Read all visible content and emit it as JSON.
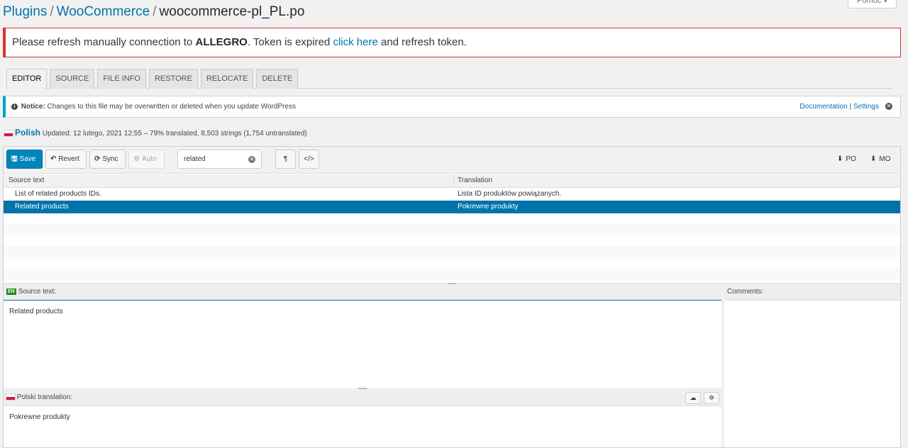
{
  "header": {
    "help_label": "Pomoc ▾",
    "breadcrumb": [
      "Plugins",
      "WooCommerce",
      "woocommerce-pl_PL.po"
    ]
  },
  "alert": {
    "before": "Please refresh manually connection to ",
    "strong": "ALLEGRO",
    "mid": ". Token is expired ",
    "link": "click here",
    "after": " and refresh token."
  },
  "tabs": [
    "EDITOR",
    "SOURCE",
    "FILE INFO",
    "RESTORE",
    "RELOCATE",
    "DELETE"
  ],
  "notice": {
    "label": "Notice:",
    "text": " Changes to this file may be overwritten or deleted when you update WordPress",
    "links": [
      "Documentation",
      "Settings"
    ],
    "close": "✕"
  },
  "language": {
    "name": "Polish",
    "info": "Updated: 12 lutego, 2021 12:55 – 79% translated, 8,503 strings (1,754 untranslated)"
  },
  "toolbar": {
    "save": "Save",
    "revert": "Revert",
    "sync": "Sync",
    "auto": "Auto",
    "search_value": "related",
    "pilcrow": "¶",
    "code": "</>",
    "download_po": "PO",
    "download_mo": "MO",
    "icons": {
      "save": "floppy-icon",
      "revert": "undo-icon",
      "sync": "refresh-icon",
      "auto": "robot-icon",
      "download": "download-icon"
    }
  },
  "list": {
    "headers": [
      "Source text",
      "Translation"
    ],
    "rows": [
      {
        "source": "List of related products IDs.",
        "translation": "Lista ID produktów powiązanych."
      },
      {
        "source": "Related products",
        "translation": "Pokrewne produkty"
      }
    ],
    "selected_index": 1
  },
  "source_pane": {
    "badge": "EN",
    "title": "Source text:",
    "text": "Related products"
  },
  "comments_pane": {
    "title": "Comments:"
  },
  "translation_pane": {
    "title": "Polski translation:",
    "text": "Pokrewne produkty"
  },
  "colors": {
    "accent": "#0073aa",
    "primary_button": "#0085ba",
    "alert_border": "#dc3232",
    "notice_border": "#00a0d2"
  }
}
